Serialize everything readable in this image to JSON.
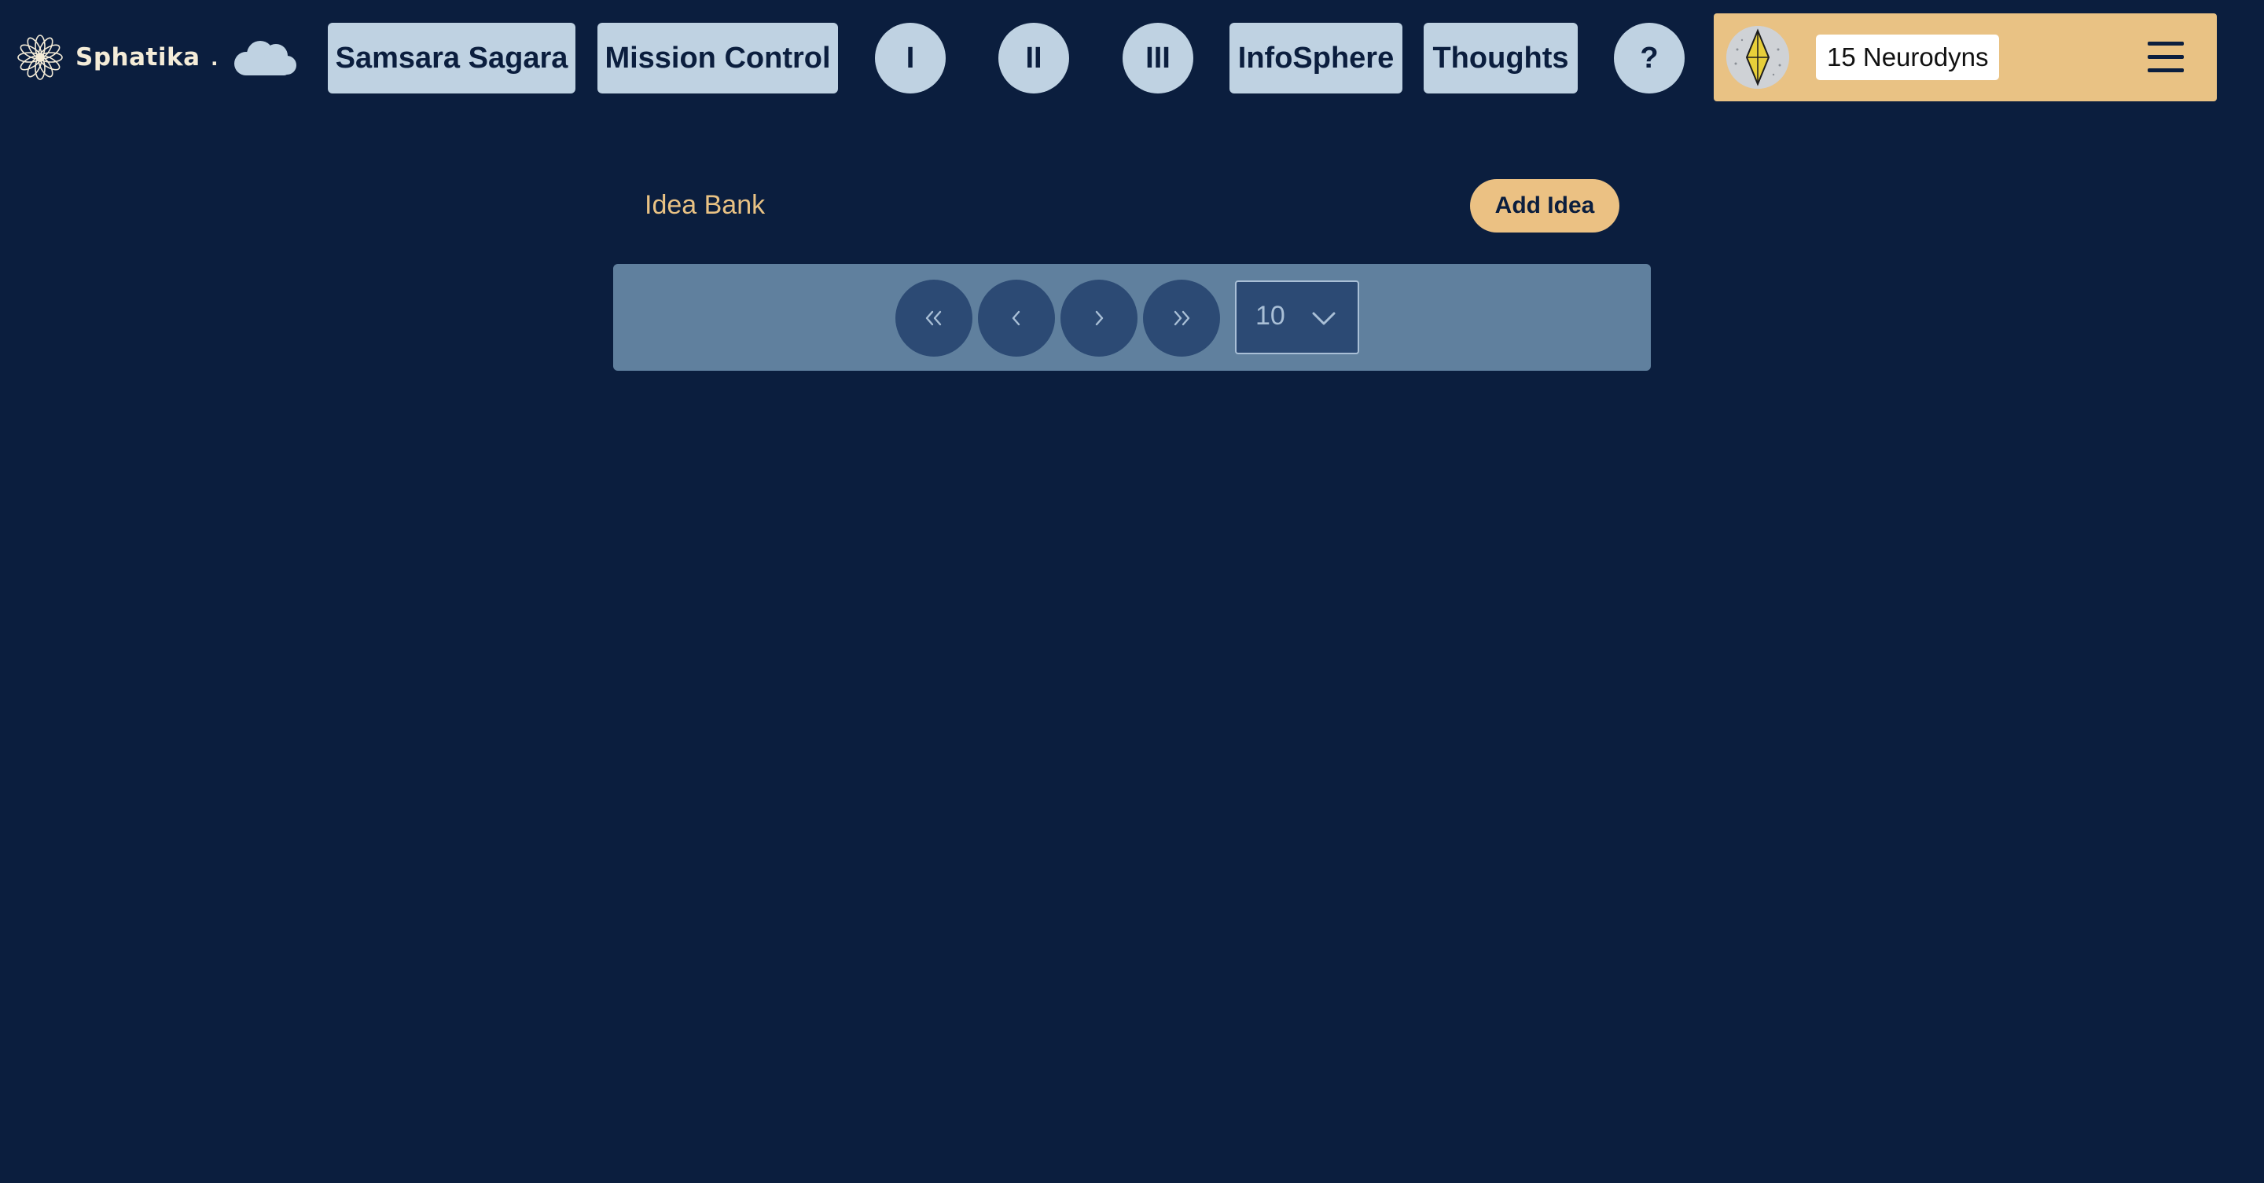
{
  "brand": {
    "name": "Sphatika",
    "dot": "."
  },
  "nav": {
    "samsara": "Samsara Sagara",
    "mission": "Mission Control",
    "level1": "I",
    "level2": "II",
    "level3": "III",
    "infosphere": "InfoSphere",
    "thoughts": "Thoughts",
    "help": "?"
  },
  "user": {
    "balance": "15 Neurodyns"
  },
  "idea_bank": {
    "title": "Idea Bank",
    "add_label": "Add Idea"
  },
  "pagination": {
    "page_size": "10"
  },
  "colors": {
    "background": "#0b1e3e",
    "nav_button": "#bfd2e2",
    "accent": "#e9c284",
    "pager_bar": "#60809e",
    "pager_button": "#2c4a74"
  },
  "icons": {
    "logo": "lotus-flower-icon",
    "cloud": "cloud-icon",
    "avatar": "crystal-icon",
    "menu": "hamburger-menu-icon",
    "first": "double-chevron-left-icon",
    "prev": "chevron-left-icon",
    "next": "chevron-right-icon",
    "last": "double-chevron-right-icon",
    "dropdown": "chevron-down-icon"
  }
}
